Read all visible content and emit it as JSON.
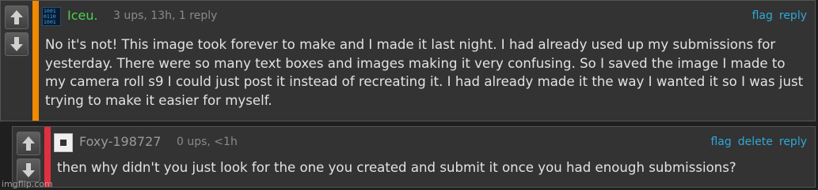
{
  "colors": {
    "accent_link": "#2fa8d6",
    "stripe_op": "#f08a00",
    "stripe_reply": "#e03040",
    "username_op": "#4bd24b",
    "username_reply": "#9a9a9a"
  },
  "comments": [
    {
      "username": "Iceu.",
      "meta": "3 ups, 13h, 1 reply",
      "actions": [
        "flag",
        "reply"
      ],
      "text": "No it's not! This image took forever to make and I made it last night. I had already used up my submissions for yesterday. There were so many text boxes and images making it very confusing. So I saved the image I made to my camera roll s9 I could just post it instead of recreating it. I had already made it the way I wanted it so I was just trying to make it easier for myself."
    },
    {
      "username": "Foxy-198727",
      "meta": "0 ups, <1h",
      "actions": [
        "flag",
        "delete",
        "reply"
      ],
      "text": "then why didn't you just look for the one you created and submit it once you had enough submissions?"
    }
  ],
  "watermark": "imgflip.com"
}
